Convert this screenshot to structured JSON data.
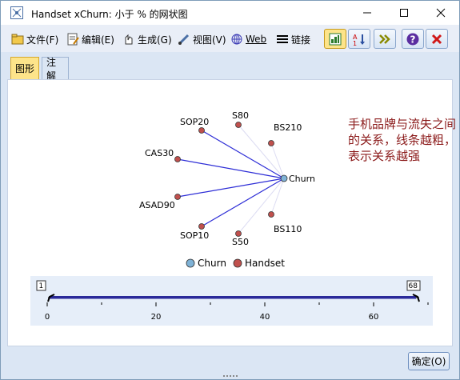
{
  "window": {
    "title": "Handset xChurn: 小于 % 的网状图"
  },
  "toolbar": {
    "file": "文件(F)",
    "edit": "编辑(E)",
    "generate": "生成(G)",
    "view": "视图(V)",
    "web": "Web",
    "link": "链接"
  },
  "tabs": {
    "graph": "图形",
    "notes": "注解"
  },
  "annotation": {
    "text": "手机品牌与流失之间的关系，线条越粗，表示关系越强"
  },
  "graph": {
    "nodes": {
      "churn": "Churn",
      "sop20": "SOP20",
      "s80": "S80",
      "bs210": "BS210",
      "cas30": "CAS30",
      "asad90": "ASAD90",
      "sop10": "SOP10",
      "s50": "S50",
      "bs110": "BS110"
    },
    "legend": {
      "churn": "Churn",
      "handset": "Handset"
    },
    "colors": {
      "churn_node": "#7fb2d6",
      "handset_node": "#c0504d",
      "strong_link": "#2d2dd6",
      "weak_link": "#dcdcf2"
    }
  },
  "slider": {
    "min_label": "1",
    "max_label": "68",
    "ticks": [
      "0",
      "20",
      "40",
      "60"
    ]
  },
  "buttons": {
    "ok": "确定(O)"
  }
}
